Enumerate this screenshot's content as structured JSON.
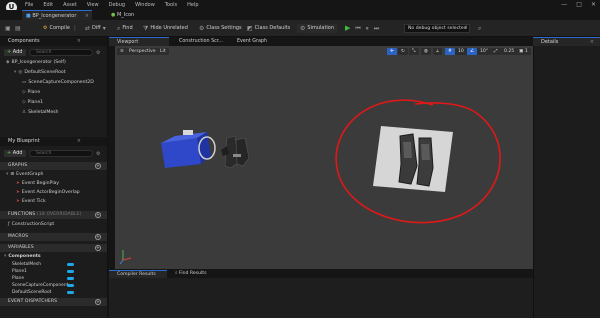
{
  "menu": [
    "File",
    "Edit",
    "Asset",
    "View",
    "Debug",
    "Window",
    "Tools",
    "Help"
  ],
  "asset_tabs": [
    {
      "label": "BP_Icongenerator",
      "active": true
    },
    {
      "label": "M_Icon",
      "active": false
    }
  ],
  "toolbar": {
    "compile": "Compile",
    "diff": "Diff",
    "find": "Find",
    "hide_unrelated": "Hide Unrelated",
    "class_settings": "Class Settings",
    "class_defaults": "Class Defaults",
    "simulation": "Simulation",
    "debug_select": "No debug object selected"
  },
  "components_panel": {
    "title": "Components",
    "add": "Add",
    "search_placeholder": "Search",
    "items": [
      "BP_Icongenerator (Self)",
      "DefaultSceneRoot",
      "SceneCaptureComponent2D",
      "Plane",
      "Plane1",
      "SkeletalMesh"
    ]
  },
  "blueprint_panel": {
    "title": "My Blueprint",
    "add": "Add",
    "search_placeholder": "Search",
    "graphs": "GRAPHS",
    "event_graph": "EventGraph",
    "events": [
      "Event BeginPlay",
      "Event ActorBeginOverlap",
      "Event Tick"
    ],
    "functions": "FUNCTIONS",
    "functions_note": "(18 OVERRIDABLE)",
    "construction_script": "ConstructionScript",
    "macros": "MACROS",
    "variables": "VARIABLES",
    "components_group": "Components",
    "variables_list": [
      "SkeletalMesh",
      "Plane1",
      "Plane",
      "SceneCaptureComponent",
      "DefaultSceneRoot"
    ],
    "event_dispatchers": "EVENT DISPATCHERS"
  },
  "viewport_tabs": [
    "Viewport",
    "Construction Scr...",
    "Event Graph"
  ],
  "viewport_bar": {
    "perspective": "Perspective",
    "lit": "Lit",
    "grid_snap": "10",
    "angle_snap": "10°",
    "scale_snap": "0.25",
    "camera_speed": "1"
  },
  "bottom_tabs": [
    "Compiler Results",
    "Find Results"
  ],
  "details": {
    "title": "Details"
  },
  "colors": {
    "accent": "#2d6bcc",
    "annotation": "#e01818",
    "variable_pill": "#20a8e8"
  }
}
